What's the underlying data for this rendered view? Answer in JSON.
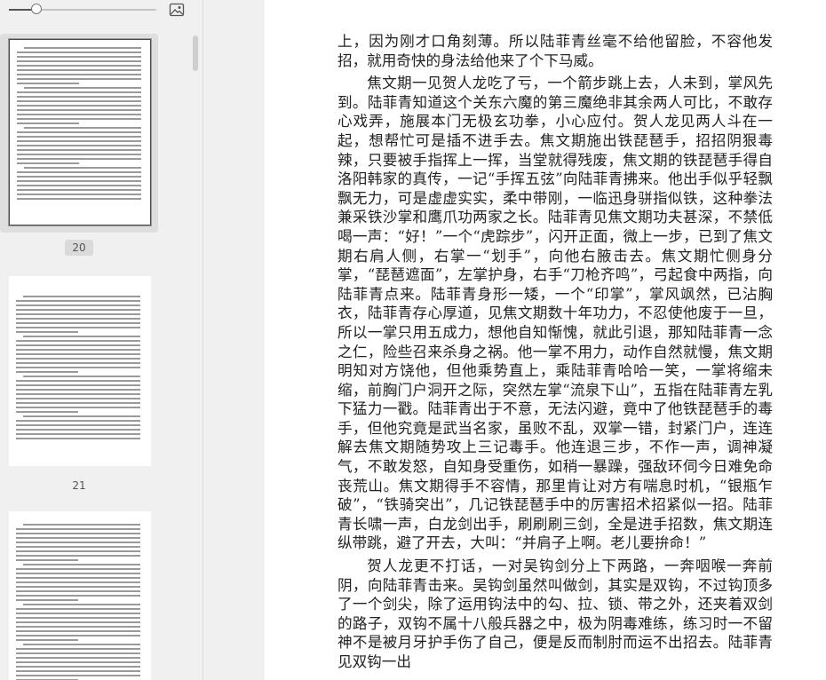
{
  "sidebar": {
    "zoom_slider": {
      "value_fraction": 0.2
    },
    "image_button_icon": "image-icon",
    "thumbnails": [
      {
        "page_label": "20",
        "active": true
      },
      {
        "page_label": "21",
        "active": false
      },
      {
        "page_label": "",
        "active": false
      }
    ]
  },
  "document": {
    "paragraphs": [
      "上，因为刚才口角刻薄。所以陆菲青丝毫不给他留脸，不容他发招，就用奇快的身法给他来了个下马威。",
      "焦文期一见贺人龙吃了亏，一个箭步跳上去，人未到，掌风先到。陆菲青知道这个关东六魔的第三魔绝非其余两人可比，不敢存心戏弄，施展本门无极玄功拳，小心应付。贺人龙见两人斗在一起，想帮忙可是插不进手去。焦文期施出铁琵琶手，招招阴狠毒辣，只要被手指挥上一挥，当堂就得残废，焦文期的铁琵琶手得自洛阳韩家的真传，一记“手挥五弦”向陆菲青拂来。他出手似乎轻飘飘无力，可是虚虚实实，柔中带刚，一临迅身骈指似铁，这种拳法兼采铁沙掌和鹰爪功两家之长。陆菲青见焦文期功夫甚深，不禁低喝一声：“好！”一个“虎踪步”，闪开正面，微上一步，已到了焦文期右肩人侧，右掌一“划手”，向他右腋击去。焦文期忙侧身分掌，“琵琶遮面”，左掌护身，右手“刀枪齐鸣”，弓起食中两指，向陆菲青点来。陆菲青身形一矮，一个“印掌”，掌风飒然，已沾胸衣，陆菲青存心厚道，见焦文期数十年功力，不忍使他废于一旦，所以一掌只用五成力，想他自知惭愧，就此引退，那知陆菲青一念之仁，险些召来杀身之祸。他一掌不用力，动作自然就慢，焦文期明知对方饶他，但他乘势直上，乘陆菲青哈哈一笑，一掌将缩未缩，前胸门户洞开之际，突然左掌“流泉下山”，五指在陆菲青左乳下猛力一戳。陆菲青出于不意，无法闪避，竟中了他铁琵琶手的毒手，但他究竟是武当名家，虽败不乱，双掌一错，封紧门户，连连解去焦文期随势攻上三记毒手。他连退三步，不作一声，调神凝气，不敢发怒，自知身受重伤，如稍一暴躁，强敌环伺今日难免命丧荒山。焦文期得手不容情，那里肯让对方有喘息时机，“银瓶乍破”，“铁骑突出”，几记铁琵琶手中的厉害招术招紧似一招。陆菲青长啸一声，白龙剑出手，刷刷刷三剑，全是进手招数，焦文期连纵带跳，避了开去，大叫：“并肩子上啊。老儿要拚命！”",
      "贺人龙更不打话，一对吴钩剑分上下两路，一奔咽喉一奔前阴，向陆菲青击来。吴钩剑虽然叫做剑，其实是双钩，不过钩顶多了一个剑尖，除了运用钩法中的勾、拉、锁、带之外，还夹着双剑的路子，双钩不属十八般兵器之中，极为阴毒难练，练习时一不留神不是被月牙护手伤了自己，便是反而制肘而运不出招去。陆菲青见双钩一出"
    ]
  }
}
